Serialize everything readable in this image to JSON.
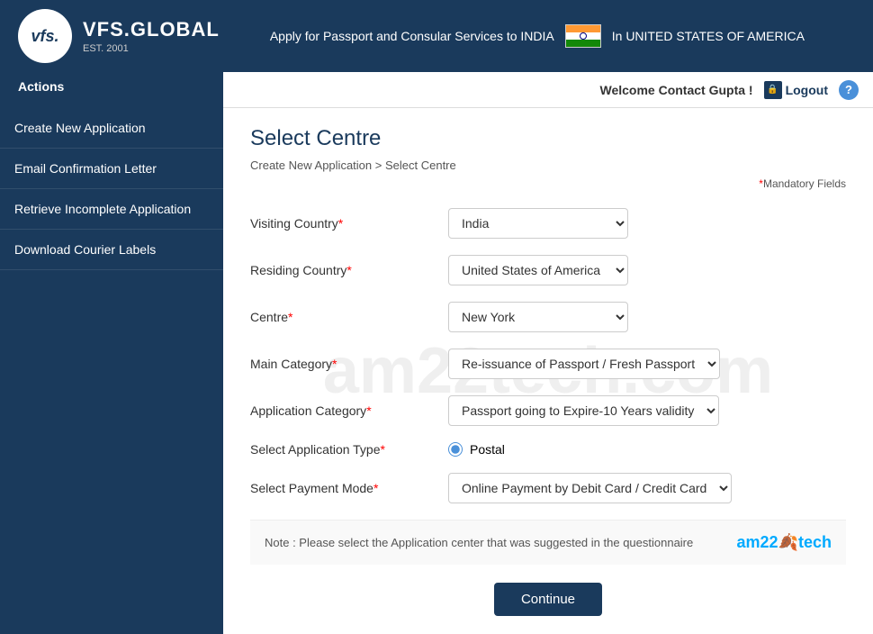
{
  "header": {
    "logo_text": "vfs.",
    "brand_name": "VFS.GLOBAL",
    "brand_sub": "EST. 2001",
    "tagline": "Apply for Passport and Consular Services to INDIA",
    "location": "In UNITED STATES OF AMERICA",
    "welcome": "Welcome Contact Gupta !",
    "logout_label": "Logout",
    "help_label": "?"
  },
  "sidebar": {
    "actions_label": "Actions",
    "items": [
      {
        "id": "create-new-application",
        "label": "Create New Application"
      },
      {
        "id": "email-confirmation-letter",
        "label": "Email Confirmation Letter"
      },
      {
        "id": "retrieve-incomplete-application",
        "label": "Retrieve Incomplete Application"
      },
      {
        "id": "download-courier-labels",
        "label": "Download Courier Labels"
      }
    ]
  },
  "page": {
    "title": "Select Centre",
    "breadcrumb_parent": "Create New Application",
    "breadcrumb_separator": " > ",
    "breadcrumb_current": "Select Centre",
    "mandatory_note": "Mandatory Fields"
  },
  "form": {
    "visiting_country_label": "Visiting Country",
    "visiting_country_value": "India",
    "residing_country_label": "Residing Country",
    "residing_country_value": "United States of America",
    "centre_label": "Centre",
    "centre_value": "New York",
    "main_category_label": "Main Category",
    "main_category_value": "Re-issuance of Passport / Fresh Passport",
    "application_category_label": "Application Category",
    "application_category_value": "Passport going to Expire-10 Years validity",
    "application_type_label": "Select Application Type",
    "application_type_value": "Postal",
    "payment_mode_label": "Select Payment Mode",
    "payment_mode_value": "Online Payment by Debit Card / Credit Card",
    "note": "Note : Please select the Application center that was suggested in the questionnaire",
    "continue_label": "Continue"
  },
  "watermark": "am22tech.com"
}
